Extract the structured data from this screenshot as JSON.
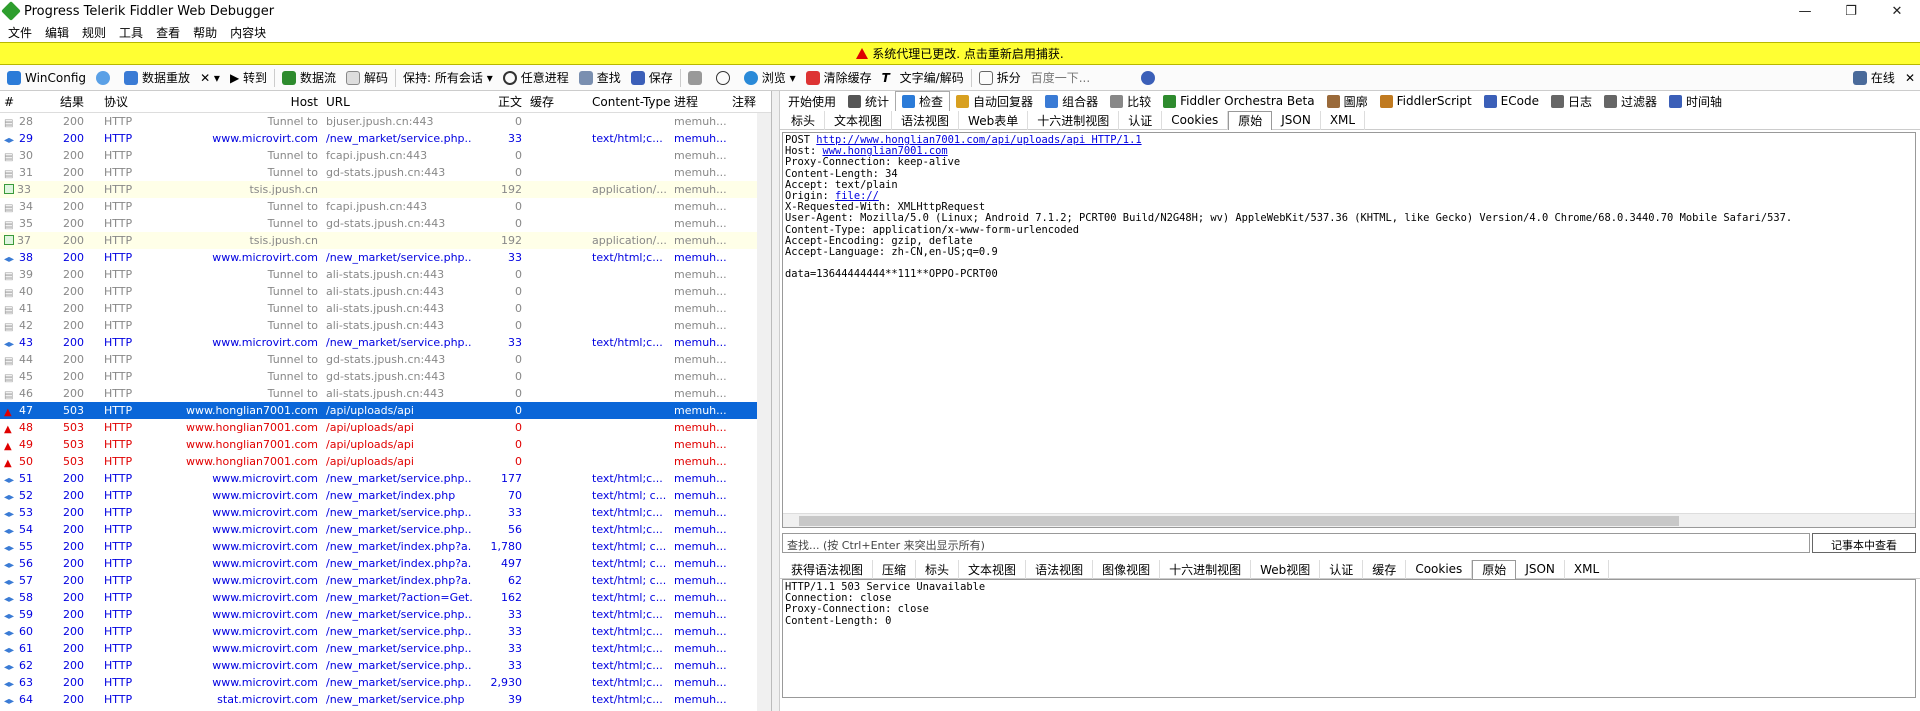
{
  "window": {
    "title": "Progress Telerik Fiddler Web Debugger",
    "min": "—",
    "max": "❐",
    "close": "✕"
  },
  "menu": [
    "文件",
    "编辑",
    "规则",
    "工具",
    "查看",
    "帮助",
    "内容块"
  ],
  "notify": {
    "text": "系统代理已更改. 点击重新启用捕获."
  },
  "toolbar": {
    "items": [
      "WinConfig",
      "数据重放",
      "✕ ▾",
      "▶ 转到",
      "数据流",
      "解码",
      "保持: 所有会话 ▾",
      "任意进程",
      "查找",
      "保存",
      "",
      "",
      "浏览 ▾",
      "清除缓存",
      "文字编/解码",
      "拆分",
      "百度一下..."
    ],
    "online": "在线",
    "close": "✕"
  },
  "columns": [
    "#",
    "结果",
    "协议",
    "Host",
    "URL",
    "正文",
    "缓存",
    "Content-Type",
    "进程",
    "注释"
  ],
  "sessions": [
    {
      "id": "28",
      "result": "200",
      "proto": "HTTP",
      "host": "Tunnel to",
      "url": "bjuser.jpush.cn:443",
      "body": "0",
      "cache": "",
      "ctype": "",
      "proc": "memuh...",
      "note": "",
      "style": "gray",
      "icon": "lock"
    },
    {
      "id": "29",
      "result": "200",
      "proto": "HTTP",
      "host": "www.microvirt.com",
      "url": "/new_market/service.php...",
      "body": "33",
      "cache": "",
      "ctype": "text/html;c...",
      "proc": "memuh...",
      "note": "",
      "style": "blue",
      "icon": "arrow"
    },
    {
      "id": "30",
      "result": "200",
      "proto": "HTTP",
      "host": "Tunnel to",
      "url": "fcapi.jpush.cn:443",
      "body": "0",
      "cache": "",
      "ctype": "",
      "proc": "memuh...",
      "note": "",
      "style": "gray",
      "icon": "lock"
    },
    {
      "id": "31",
      "result": "200",
      "proto": "HTTP",
      "host": "Tunnel to",
      "url": "gd-stats.jpush.cn:443",
      "body": "0",
      "cache": "",
      "ctype": "",
      "proc": "memuh...",
      "note": "",
      "style": "gray",
      "icon": "lock"
    },
    {
      "id": "33",
      "result": "200",
      "proto": "HTTP",
      "host": "tsis.jpush.cn",
      "url": "",
      "body": "192",
      "cache": "",
      "ctype": "application/...",
      "proc": "memuh...",
      "note": "",
      "style": "hl",
      "icon": "img"
    },
    {
      "id": "34",
      "result": "200",
      "proto": "HTTP",
      "host": "Tunnel to",
      "url": "fcapi.jpush.cn:443",
      "body": "0",
      "cache": "",
      "ctype": "",
      "proc": "memuh...",
      "note": "",
      "style": "gray",
      "icon": "lock"
    },
    {
      "id": "35",
      "result": "200",
      "proto": "HTTP",
      "host": "Tunnel to",
      "url": "gd-stats.jpush.cn:443",
      "body": "0",
      "cache": "",
      "ctype": "",
      "proc": "memuh...",
      "note": "",
      "style": "gray",
      "icon": "lock"
    },
    {
      "id": "37",
      "result": "200",
      "proto": "HTTP",
      "host": "tsis.jpush.cn",
      "url": "",
      "body": "192",
      "cache": "",
      "ctype": "application/...",
      "proc": "memuh...",
      "note": "",
      "style": "hl",
      "icon": "img"
    },
    {
      "id": "38",
      "result": "200",
      "proto": "HTTP",
      "host": "www.microvirt.com",
      "url": "/new_market/service.php...",
      "body": "33",
      "cache": "",
      "ctype": "text/html;c...",
      "proc": "memuh...",
      "note": "",
      "style": "blue",
      "icon": "arrow"
    },
    {
      "id": "39",
      "result": "200",
      "proto": "HTTP",
      "host": "Tunnel to",
      "url": "ali-stats.jpush.cn:443",
      "body": "0",
      "cache": "",
      "ctype": "",
      "proc": "memuh...",
      "note": "",
      "style": "gray",
      "icon": "lock"
    },
    {
      "id": "40",
      "result": "200",
      "proto": "HTTP",
      "host": "Tunnel to",
      "url": "ali-stats.jpush.cn:443",
      "body": "0",
      "cache": "",
      "ctype": "",
      "proc": "memuh...",
      "note": "",
      "style": "gray",
      "icon": "lock"
    },
    {
      "id": "41",
      "result": "200",
      "proto": "HTTP",
      "host": "Tunnel to",
      "url": "ali-stats.jpush.cn:443",
      "body": "0",
      "cache": "",
      "ctype": "",
      "proc": "memuh...",
      "note": "",
      "style": "gray",
      "icon": "lock"
    },
    {
      "id": "42",
      "result": "200",
      "proto": "HTTP",
      "host": "Tunnel to",
      "url": "ali-stats.jpush.cn:443",
      "body": "0",
      "cache": "",
      "ctype": "",
      "proc": "memuh...",
      "note": "",
      "style": "gray",
      "icon": "lock"
    },
    {
      "id": "43",
      "result": "200",
      "proto": "HTTP",
      "host": "www.microvirt.com",
      "url": "/new_market/service.php...",
      "body": "33",
      "cache": "",
      "ctype": "text/html;c...",
      "proc": "memuh...",
      "note": "",
      "style": "blue",
      "icon": "arrow"
    },
    {
      "id": "44",
      "result": "200",
      "proto": "HTTP",
      "host": "Tunnel to",
      "url": "gd-stats.jpush.cn:443",
      "body": "0",
      "cache": "",
      "ctype": "",
      "proc": "memuh...",
      "note": "",
      "style": "gray",
      "icon": "lock"
    },
    {
      "id": "45",
      "result": "200",
      "proto": "HTTP",
      "host": "Tunnel to",
      "url": "gd-stats.jpush.cn:443",
      "body": "0",
      "cache": "",
      "ctype": "",
      "proc": "memuh...",
      "note": "",
      "style": "gray",
      "icon": "lock"
    },
    {
      "id": "46",
      "result": "200",
      "proto": "HTTP",
      "host": "Tunnel to",
      "url": "ali-stats.jpush.cn:443",
      "body": "0",
      "cache": "",
      "ctype": "",
      "proc": "memuh...",
      "note": "",
      "style": "gray",
      "icon": "lock"
    },
    {
      "id": "47",
      "result": "503",
      "proto": "HTTP",
      "host": "www.honglian7001.com",
      "url": "/api/uploads/api",
      "body": "0",
      "cache": "",
      "ctype": "",
      "proc": "memuh...",
      "note": "",
      "style": "sel",
      "icon": "err"
    },
    {
      "id": "48",
      "result": "503",
      "proto": "HTTP",
      "host": "www.honglian7001.com",
      "url": "/api/uploads/api",
      "body": "0",
      "cache": "",
      "ctype": "",
      "proc": "memuh...",
      "note": "",
      "style": "red",
      "icon": "err"
    },
    {
      "id": "49",
      "result": "503",
      "proto": "HTTP",
      "host": "www.honglian7001.com",
      "url": "/api/uploads/api",
      "body": "0",
      "cache": "",
      "ctype": "",
      "proc": "memuh...",
      "note": "",
      "style": "red",
      "icon": "err"
    },
    {
      "id": "50",
      "result": "503",
      "proto": "HTTP",
      "host": "www.honglian7001.com",
      "url": "/api/uploads/api",
      "body": "0",
      "cache": "",
      "ctype": "",
      "proc": "memuh...",
      "note": "",
      "style": "red",
      "icon": "err"
    },
    {
      "id": "51",
      "result": "200",
      "proto": "HTTP",
      "host": "www.microvirt.com",
      "url": "/new_market/service.php...",
      "body": "177",
      "cache": "",
      "ctype": "text/html;c...",
      "proc": "memuh...",
      "note": "",
      "style": "blue",
      "icon": "arrow"
    },
    {
      "id": "52",
      "result": "200",
      "proto": "HTTP",
      "host": "www.microvirt.com",
      "url": "/new_market/index.php",
      "body": "70",
      "cache": "",
      "ctype": "text/html; c...",
      "proc": "memuh...",
      "note": "",
      "style": "blue",
      "icon": "arrow"
    },
    {
      "id": "53",
      "result": "200",
      "proto": "HTTP",
      "host": "www.microvirt.com",
      "url": "/new_market/service.php...",
      "body": "33",
      "cache": "",
      "ctype": "text/html;c...",
      "proc": "memuh...",
      "note": "",
      "style": "blue",
      "icon": "arrow"
    },
    {
      "id": "54",
      "result": "200",
      "proto": "HTTP",
      "host": "www.microvirt.com",
      "url": "/new_market/service.php...",
      "body": "56",
      "cache": "",
      "ctype": "text/html;c...",
      "proc": "memuh...",
      "note": "",
      "style": "blue",
      "icon": "arrow"
    },
    {
      "id": "55",
      "result": "200",
      "proto": "HTTP",
      "host": "www.microvirt.com",
      "url": "/new_market/index.php?a...",
      "body": "1,780",
      "cache": "",
      "ctype": "text/html; c...",
      "proc": "memuh...",
      "note": "",
      "style": "blue",
      "icon": "arrow"
    },
    {
      "id": "56",
      "result": "200",
      "proto": "HTTP",
      "host": "www.microvirt.com",
      "url": "/new_market/index.php?a...",
      "body": "497",
      "cache": "",
      "ctype": "text/html; c...",
      "proc": "memuh...",
      "note": "",
      "style": "blue",
      "icon": "arrow"
    },
    {
      "id": "57",
      "result": "200",
      "proto": "HTTP",
      "host": "www.microvirt.com",
      "url": "/new_market/index.php?a...",
      "body": "62",
      "cache": "",
      "ctype": "text/html; c...",
      "proc": "memuh...",
      "note": "",
      "style": "blue",
      "icon": "arrow"
    },
    {
      "id": "58",
      "result": "200",
      "proto": "HTTP",
      "host": "www.microvirt.com",
      "url": "/new_market/?action=Get...",
      "body": "162",
      "cache": "",
      "ctype": "text/html; c...",
      "proc": "memuh...",
      "note": "",
      "style": "blue",
      "icon": "arrow"
    },
    {
      "id": "59",
      "result": "200",
      "proto": "HTTP",
      "host": "www.microvirt.com",
      "url": "/new_market/service.php...",
      "body": "33",
      "cache": "",
      "ctype": "text/html;c...",
      "proc": "memuh...",
      "note": "",
      "style": "blue",
      "icon": "arrow"
    },
    {
      "id": "60",
      "result": "200",
      "proto": "HTTP",
      "host": "www.microvirt.com",
      "url": "/new_market/service.php...",
      "body": "33",
      "cache": "",
      "ctype": "text/html;c...",
      "proc": "memuh...",
      "note": "",
      "style": "blue",
      "icon": "arrow"
    },
    {
      "id": "61",
      "result": "200",
      "proto": "HTTP",
      "host": "www.microvirt.com",
      "url": "/new_market/service.php...",
      "body": "33",
      "cache": "",
      "ctype": "text/html;c...",
      "proc": "memuh...",
      "note": "",
      "style": "blue",
      "icon": "arrow"
    },
    {
      "id": "62",
      "result": "200",
      "proto": "HTTP",
      "host": "www.microvirt.com",
      "url": "/new_market/service.php...",
      "body": "33",
      "cache": "",
      "ctype": "text/html;c...",
      "proc": "memuh...",
      "note": "",
      "style": "blue",
      "icon": "arrow"
    },
    {
      "id": "63",
      "result": "200",
      "proto": "HTTP",
      "host": "www.microvirt.com",
      "url": "/new_market/service.php...",
      "body": "2,930",
      "cache": "",
      "ctype": "text/html;c...",
      "proc": "memuh...",
      "note": "",
      "style": "blue",
      "icon": "arrow"
    },
    {
      "id": "64",
      "result": "200",
      "proto": "HTTP",
      "host": "stat.microvirt.com",
      "url": "/new_market/service.php",
      "body": "39",
      "cache": "",
      "ctype": "text/html;c...",
      "proc": "memuh...",
      "note": "",
      "style": "blue",
      "icon": "arrow"
    }
  ],
  "inspector": {
    "tabs": [
      "开始使用",
      "统计",
      "检查",
      "自动回复器",
      "组合器",
      "比较",
      "Fiddler Orchestra Beta",
      "圖廓",
      "FiddlerScript",
      "ECode",
      "日志",
      "过滤器",
      "时间轴"
    ],
    "active_tab": "检查",
    "request_tabs": [
      "标头",
      "文本视图",
      "语法视图",
      "Web表单",
      "十六进制视图",
      "认证",
      "Cookies",
      "原始",
      "JSON",
      "XML"
    ],
    "request_active": "原始",
    "request_lines": [
      "POST ",
      "Host: ",
      "Proxy-Connection: keep-alive",
      "Content-Length: 34",
      "Accept: text/plain",
      "Origin: ",
      "X-Requested-With: XMLHttpRequest",
      "User-Agent: Mozilla/5.0 (Linux; Android 7.1.2; PCRT00 Build/N2G48H; wv) AppleWebKit/537.36 (KHTML, like Gecko) Version/4.0 Chrome/68.0.3440.70 Mobile Safari/537.",
      "Content-Type: application/x-www-form-urlencoded",
      "Accept-Encoding: gzip, deflate",
      "Accept-Language: zh-CN,en-US;q=0.9",
      "",
      "data=13644444444**111**OPPO-PCRT00"
    ],
    "request_url": "http://www.honglian7001.com/api/uploads/api HTTP/1.1",
    "host_link": "www.honglian7001.com",
    "origin_link": "file://",
    "find_placeholder": "查找... (按 Ctrl+Enter 来突出显示所有)",
    "find_button": "记事本中查看",
    "response_tabs": [
      "获得语法视图",
      "压缩",
      "标头",
      "文本视图",
      "语法视图",
      "图像视图",
      "十六进制视图",
      "Web视图",
      "认证",
      "缓存",
      "Cookies",
      "原始",
      "JSON",
      "XML"
    ],
    "response_active": "原始",
    "response_lines": [
      "HTTP/1.1 503 Service Unavailable",
      "Connection: close",
      "Proxy-Connection: close",
      "Content-Length: 0"
    ]
  }
}
